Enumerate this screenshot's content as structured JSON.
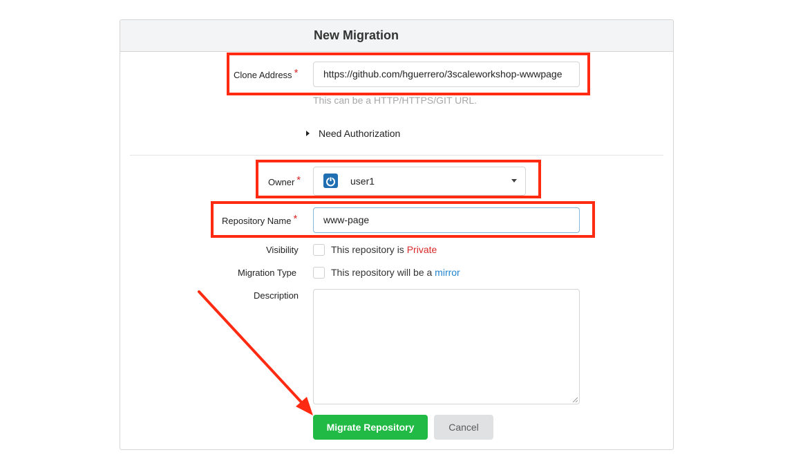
{
  "page": {
    "title": "New Migration"
  },
  "form": {
    "clone_address": {
      "label": "Clone Address",
      "required_marker": "*",
      "value": "https://github.com/hguerrero/3scaleworkshop-wwwpage",
      "help": "This can be a HTTP/HTTPS/GIT URL."
    },
    "need_authorization": {
      "label": "Need Authorization"
    },
    "owner": {
      "label": "Owner",
      "required_marker": "*",
      "selected": "user1",
      "icon": "power-icon"
    },
    "repository_name": {
      "label": "Repository Name",
      "required_marker": "*",
      "value": "www-page"
    },
    "visibility": {
      "label": "Visibility",
      "text": "This repository is ",
      "emphasis": "Private",
      "checked": false
    },
    "migration_type": {
      "label": "Migration Type",
      "text": "This repository will be a ",
      "emphasis": "mirror",
      "checked": false
    },
    "description": {
      "label": "Description",
      "value": ""
    }
  },
  "actions": {
    "migrate_label": "Migrate Repository",
    "cancel_label": "Cancel"
  },
  "colors": {
    "accent_green": "#21ba45",
    "required_red": "#db2828",
    "link_blue": "#2185d0",
    "annotation_red": "#ff2a12"
  }
}
